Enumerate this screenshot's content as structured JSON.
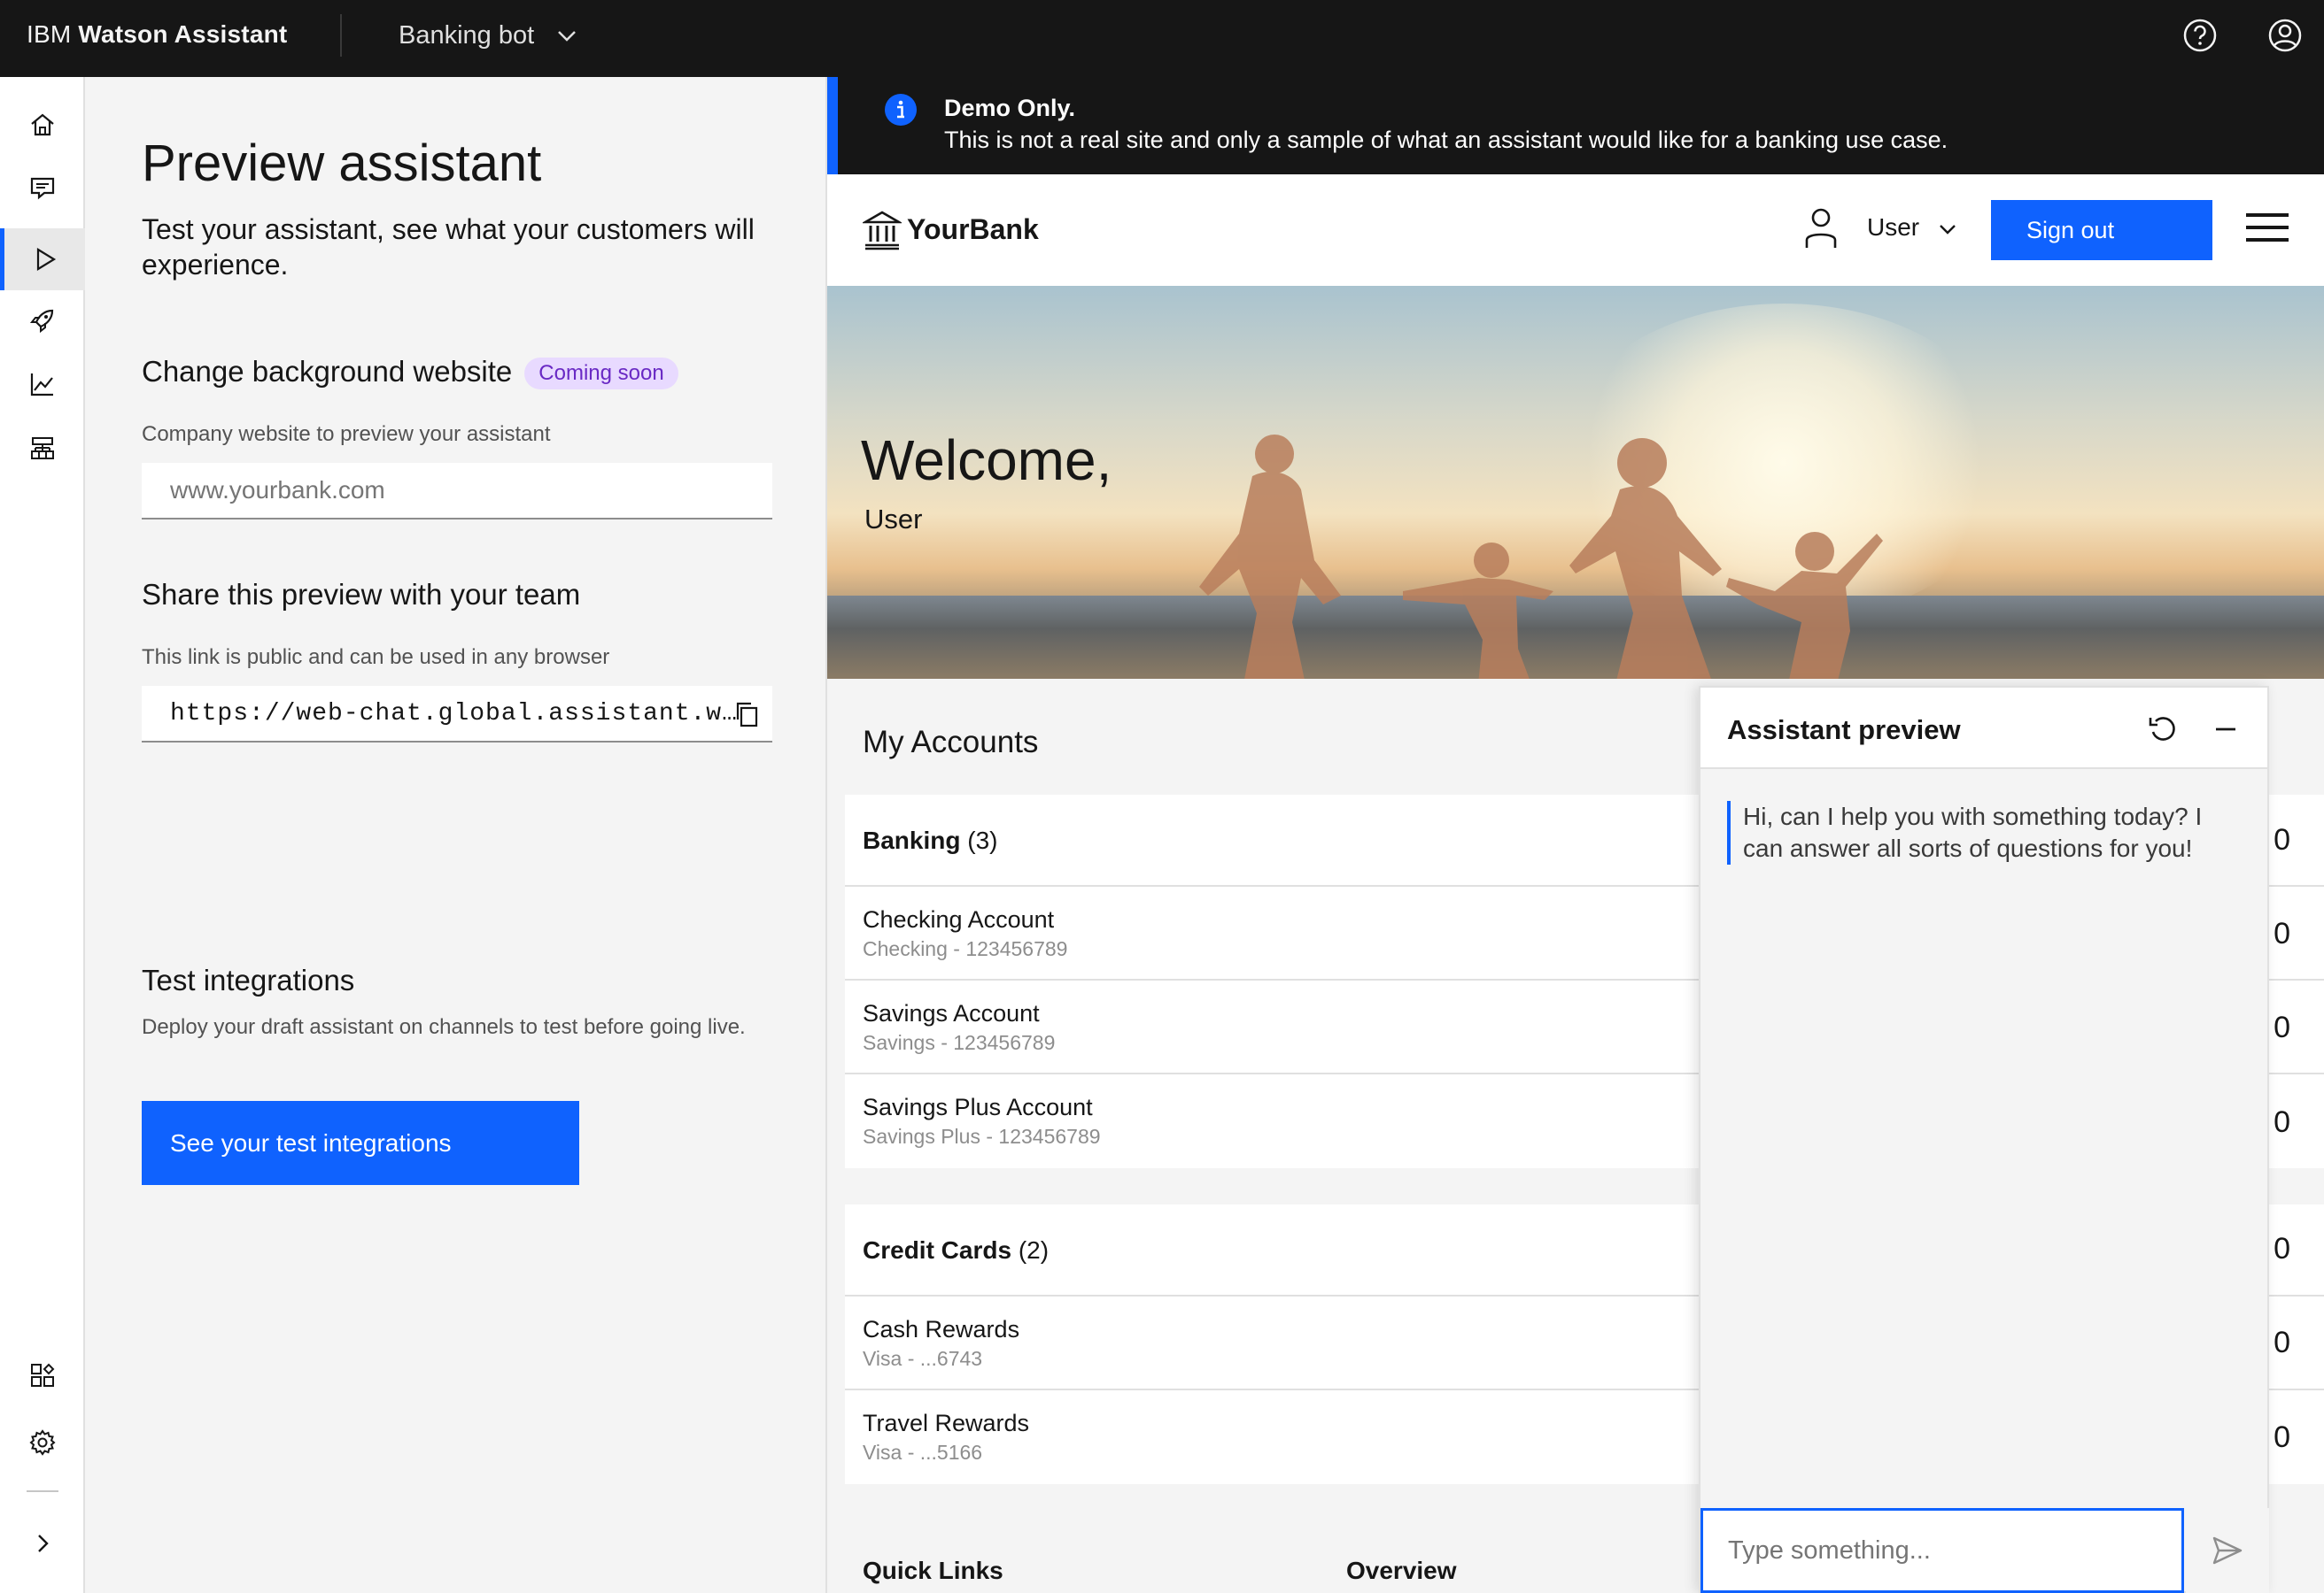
{
  "topbar": {
    "brand_prefix": "IBM",
    "brand_name": "Watson Assistant",
    "project": "Banking bot"
  },
  "panel": {
    "title": "Preview assistant",
    "lead": "Test your assistant, see what your customers will experience.",
    "background": {
      "heading": "Change background website",
      "tag": "Coming soon",
      "helper": "Company website to preview your assistant",
      "placeholder": "www.yourbank.com"
    },
    "share": {
      "heading": "Share this preview with your team",
      "helper": "This link is public and can be used in any browser",
      "link": "https://web-chat.global.assistant.w…"
    },
    "integrations": {
      "heading": "Test integrations",
      "helper": "Deploy your draft assistant on channels to test before going live.",
      "button": "See your test integrations"
    }
  },
  "site": {
    "demo_title": "Demo Only.",
    "demo_text": "This is not a real site and only a sample of what an assistant would like for a banking use case.",
    "bank_name": "YourBank",
    "user_menu": "User",
    "sign_out": "Sign out",
    "welcome": "Welcome,",
    "welcome_user": "User",
    "my_accounts": "My Accounts",
    "banking": {
      "label": "Banking",
      "count": "(3)",
      "rows": [
        {
          "name": "Checking Account",
          "detail": "Checking - 123456789"
        },
        {
          "name": "Savings Account",
          "detail": "Savings - 123456789"
        },
        {
          "name": "Savings Plus Account",
          "detail": "Savings Plus - 123456789"
        }
      ]
    },
    "credit": {
      "label": "Credit Cards",
      "count": "(2)",
      "rows": [
        {
          "name": "Cash Rewards",
          "detail": "Visa - ...6743"
        },
        {
          "name": "Travel Rewards",
          "detail": "Visa - ...5166"
        }
      ]
    },
    "balance_fragment": "0",
    "quick_links": "Quick Links",
    "overview": "Overview"
  },
  "chat": {
    "title": "Assistant preview",
    "greeting": "Hi, can I help you with something today? I can answer all sorts of questions for you!",
    "input_placeholder": "Type something..."
  },
  "colors": {
    "accent": "#0f62fe",
    "topbar": "#161616",
    "tag_bg": "#e8daff",
    "tag_fg": "#6929c4"
  }
}
